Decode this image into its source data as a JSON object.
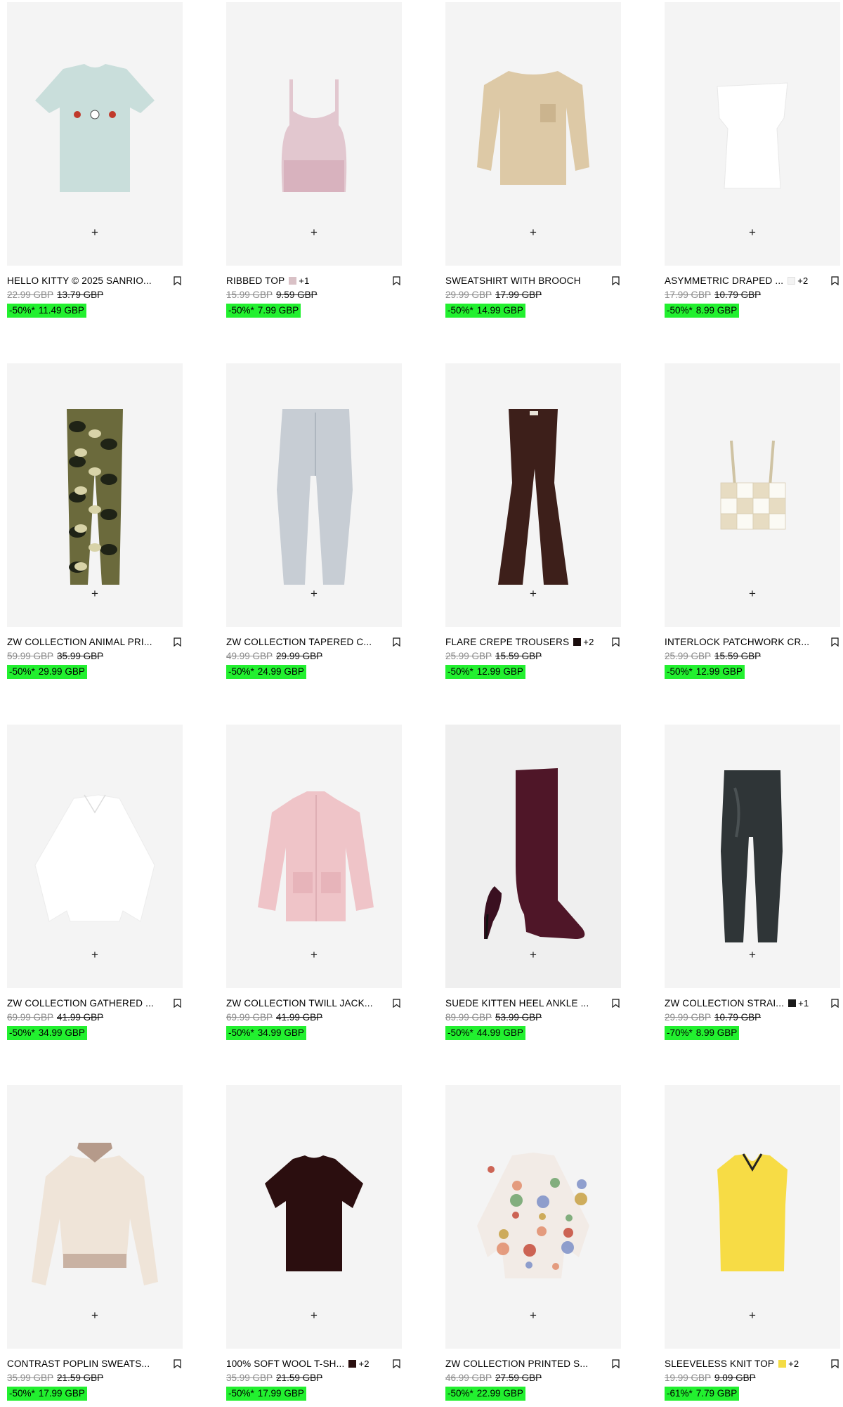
{
  "products": [
    {
      "name": "HELLO KITTY © 2025 SANRIO...",
      "swatch": null,
      "more": null,
      "original_price": "22.99 GBP",
      "previous_price": "13.79 GBP",
      "discount": "-50%*",
      "sale_price": "11.49 GBP",
      "image": "tshirt-mint"
    },
    {
      "name": "RIBBED TOP",
      "swatch": "#d9c1c6",
      "more": "+1",
      "original_price": "15.99 GBP",
      "previous_price": "9.59 GBP",
      "discount": "-50%*",
      "sale_price": "7.99 GBP",
      "image": "tank-pink"
    },
    {
      "name": "SWEATSHIRT WITH BROOCH",
      "swatch": null,
      "more": null,
      "original_price": "29.99 GBP",
      "previous_price": "17.99 GBP",
      "discount": "-50%*",
      "sale_price": "14.99 GBP",
      "image": "sweatshirt-beige"
    },
    {
      "name": "ASYMMETRIC DRAPED ...",
      "swatch": "#f3f3f3",
      "more": "+2",
      "original_price": "17.99 GBP",
      "previous_price": "10.79 GBP",
      "discount": "-50%*",
      "sale_price": "8.99 GBP",
      "image": "top-white"
    },
    {
      "name": "ZW COLLECTION ANIMAL PRI...",
      "swatch": null,
      "more": null,
      "original_price": "59.99 GBP",
      "previous_price": "35.99 GBP",
      "discount": "-50%*",
      "sale_price": "29.99 GBP",
      "image": "trousers-snake"
    },
    {
      "name": "ZW COLLECTION TAPERED C...",
      "swatch": null,
      "more": null,
      "original_price": "49.99 GBP",
      "previous_price": "29.99 GBP",
      "discount": "-50%*",
      "sale_price": "24.99 GBP",
      "image": "jeans-grey"
    },
    {
      "name": "FLARE CREPE TROUSERS",
      "swatch": "#1a0d0d",
      "more": "+2",
      "original_price": "25.99 GBP",
      "previous_price": "15.59 GBP",
      "discount": "-50%*",
      "sale_price": "12.99 GBP",
      "image": "flare-brown"
    },
    {
      "name": "INTERLOCK PATCHWORK CR...",
      "swatch": null,
      "more": null,
      "original_price": "25.99 GBP",
      "previous_price": "15.59 GBP",
      "discount": "-50%*",
      "sale_price": "12.99 GBP",
      "image": "crochet-top"
    },
    {
      "name": "ZW COLLECTION GATHERED ...",
      "swatch": null,
      "more": null,
      "original_price": "69.99 GBP",
      "previous_price": "41.99 GBP",
      "discount": "-50%*",
      "sale_price": "34.99 GBP",
      "image": "blouse-white"
    },
    {
      "name": "ZW COLLECTION TWILL JACK...",
      "swatch": null,
      "more": null,
      "original_price": "69.99 GBP",
      "previous_price": "41.99 GBP",
      "discount": "-50%*",
      "sale_price": "34.99 GBP",
      "image": "jacket-pink"
    },
    {
      "name": "SUEDE KITTEN HEEL ANKLE ...",
      "swatch": null,
      "more": null,
      "original_price": "89.99 GBP",
      "previous_price": "53.99 GBP",
      "discount": "-50%*",
      "sale_price": "44.99 GBP",
      "image": "boot-burgundy"
    },
    {
      "name": "ZW COLLECTION STRAI...",
      "swatch": "#1a1a1a",
      "more": "+1",
      "original_price": "29.99 GBP",
      "previous_price": "10.79 GBP",
      "discount": "-70%*",
      "sale_price": "8.99 GBP",
      "image": "jeans-black"
    },
    {
      "name": "CONTRAST POPLIN SWEATS...",
      "swatch": null,
      "more": null,
      "original_price": "35.99 GBP",
      "previous_price": "21.59 GBP",
      "discount": "-50%*",
      "sale_price": "17.99 GBP",
      "image": "sweat-cream"
    },
    {
      "name": "100% SOFT WOOL T-SH...",
      "swatch": "#2a0f0f",
      "more": "+2",
      "original_price": "35.99 GBP",
      "previous_price": "21.59 GBP",
      "discount": "-50%*",
      "sale_price": "17.99 GBP",
      "image": "tee-burgundy"
    },
    {
      "name": "ZW COLLECTION PRINTED S...",
      "swatch": null,
      "more": null,
      "original_price": "46.99 GBP",
      "previous_price": "27.59 GBP",
      "discount": "-50%*",
      "sale_price": "22.99 GBP",
      "image": "blouse-paisley"
    },
    {
      "name": "SLEEVELESS KNIT TOP",
      "swatch": "#f4dc45",
      "more": "+2",
      "original_price": "19.99 GBP",
      "previous_price": "9.09 GBP",
      "discount": "-61%*",
      "sale_price": "7.79 GBP",
      "image": "vest-yellow"
    }
  ],
  "add_label": "+",
  "colors": {
    "sale_bg": "#22f02f",
    "image_bg": "#f4f4f4",
    "strike_grey": "#8a8a8a"
  }
}
